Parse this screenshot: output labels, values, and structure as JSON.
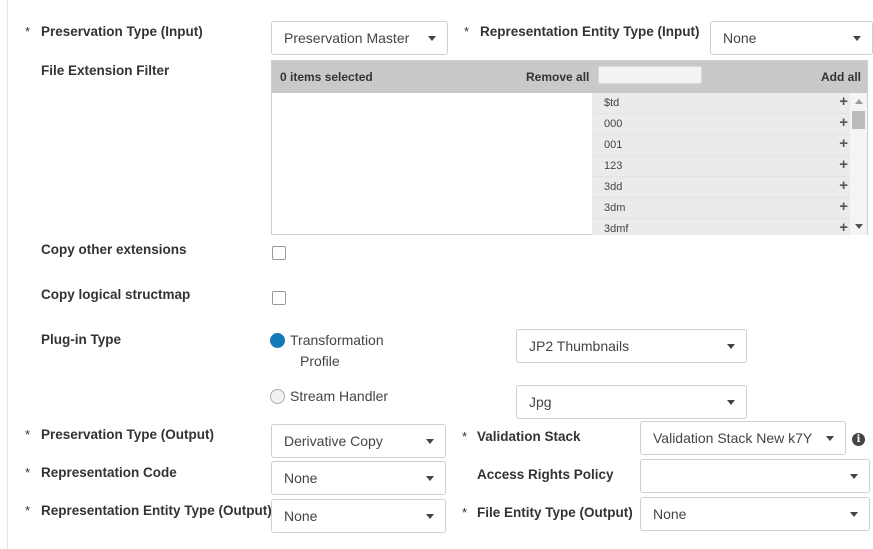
{
  "required_mark": "*",
  "preservation_type_input": {
    "label": "Preservation Type (Input)",
    "value": "Preservation Master"
  },
  "representation_entity_type_input": {
    "label": "Representation Entity Type (Input)",
    "value": "None"
  },
  "file_extension_filter": {
    "label": "File Extension Filter",
    "selected_count": "0 items selected",
    "remove_all": "Remove all",
    "add_all": "Add all",
    "filter_placeholder": "",
    "available": [
      "$td",
      "000",
      "001",
      "123",
      "3dd",
      "3dm",
      "3dmf"
    ],
    "add_icon": "plus-icon"
  },
  "copy_other_extensions": {
    "label": "Copy other extensions",
    "checked": false
  },
  "copy_logical_structmap": {
    "label": "Copy logical structmap",
    "checked": false
  },
  "plugin_type": {
    "label": "Plug-in Type",
    "options": [
      {
        "line1": "Transformation",
        "line2": "Profile",
        "selected": true,
        "select_value": "JP2 Thumbnails"
      },
      {
        "line1": "Stream Handler",
        "selected": false,
        "select_value": "Jpg"
      }
    ]
  },
  "preservation_type_output": {
    "label": "Preservation Type (Output)",
    "value": "Derivative Copy"
  },
  "validation_stack": {
    "label": "Validation Stack",
    "value": "Validation Stack New k7Y",
    "info_icon": "info-icon",
    "info_glyph": "i"
  },
  "representation_code": {
    "label": "Representation Code",
    "value": "None"
  },
  "access_rights_policy": {
    "label": "Access Rights Policy",
    "value": ""
  },
  "representation_entity_type_output": {
    "label": "Representation Entity Type (Output)",
    "value": "None"
  },
  "file_entity_type_output": {
    "label": "File Entity Type (Output)",
    "value": "None"
  },
  "colors": {
    "accent": "#1479b8",
    "header_gray": "#c9c9c9",
    "border": "#cfcfcf"
  }
}
